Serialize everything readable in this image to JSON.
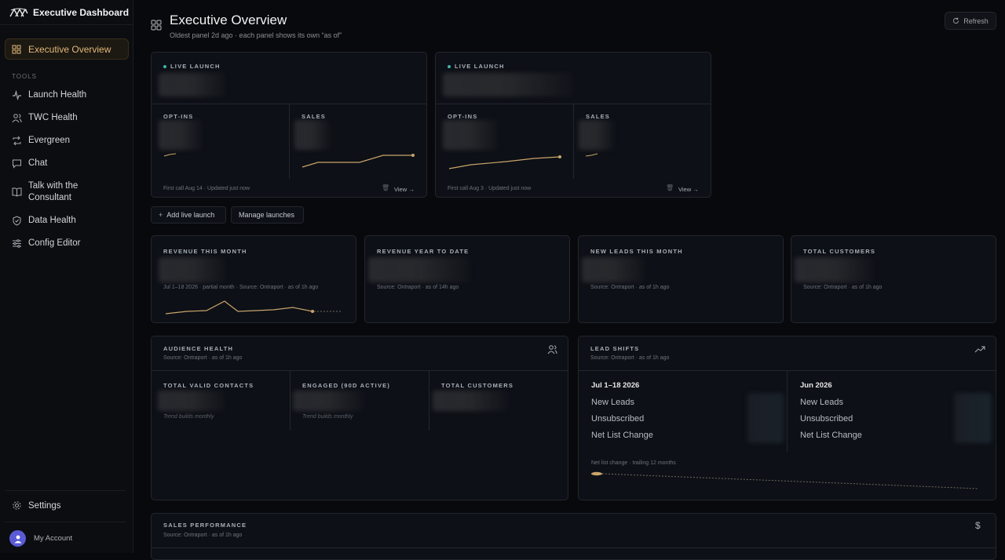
{
  "app": {
    "title": "Executive Dashboard"
  },
  "sidebar": {
    "active": "Executive Overview",
    "section": "TOOLS",
    "items": [
      {
        "label": "Launch Health",
        "icon": "activity-icon"
      },
      {
        "label": "TWC Health",
        "icon": "users-icon"
      },
      {
        "label": "Evergreen",
        "icon": "repeat-icon"
      },
      {
        "label": "Chat",
        "icon": "chat-icon"
      },
      {
        "label": "Talk with the Consultant",
        "icon": "book-icon"
      },
      {
        "label": "Data Health",
        "icon": "shield-icon"
      },
      {
        "label": "Config Editor",
        "icon": "sliders-icon"
      }
    ],
    "settings": "Settings",
    "account": "My Account"
  },
  "header": {
    "title": "Executive Overview",
    "subtitle": "Oldest panel 2d ago · each panel shows its own “as of”",
    "refresh": "Refresh"
  },
  "launches": [
    {
      "badge": "LIVE LAUNCH",
      "optins": "OPT-INS",
      "sales": "SALES",
      "meta": "First call Aug 14 · Updated just now",
      "view": "View →"
    },
    {
      "badge": "LIVE LAUNCH",
      "optins": "OPT-INS",
      "sales": "SALES",
      "meta": "First call Aug 3 · Updated just now",
      "view": "View →"
    }
  ],
  "actions": {
    "add": "Add live launch",
    "manage": "Manage launches"
  },
  "kpis": [
    {
      "label": "REVENUE THIS MONTH",
      "meta": "Jul 1–18 2026 · partial month · Source: Ontraport · as of 1h ago"
    },
    {
      "label": "REVENUE YEAR TO DATE",
      "meta": "Source: Ontraport · as of 14h ago"
    },
    {
      "label": "NEW LEADS THIS MONTH",
      "meta": "Source: Ontraport · as of 1h ago"
    },
    {
      "label": "TOTAL CUSTOMERS",
      "meta": "Source: Ontraport · as of 1h ago"
    }
  ],
  "audience": {
    "title": "AUDIENCE HEALTH",
    "meta": "Source: Ontraport · as of 1h ago",
    "cols": [
      {
        "label": "TOTAL VALID CONTACTS",
        "note": "Trend builds monthly"
      },
      {
        "label": "ENGAGED (90D ACTIVE)",
        "note": "Trend builds monthly"
      },
      {
        "label": "TOTAL CUSTOMERS",
        "note": ""
      }
    ]
  },
  "lead_shifts": {
    "title": "LEAD SHIFTS",
    "meta": "Source: Ontraport · as of 1h ago",
    "periods": [
      {
        "title": "Jul 1–18 2026",
        "rows": [
          "New Leads",
          "Unsubscribed",
          "Net List Change"
        ]
      },
      {
        "title": "Jun 2026",
        "rows": [
          "New Leads",
          "Unsubscribed",
          "Net List Change"
        ]
      }
    ],
    "trend_label": "Net list change · trailing 12 months"
  },
  "sales_perf": {
    "title": "SALES PERFORMANCE",
    "meta": "Source: Ontraport · as of 1h ago"
  },
  "colors": {
    "accent": "#e2b979",
    "live_dot": "#3fb6a8",
    "bg": "#07090c"
  }
}
